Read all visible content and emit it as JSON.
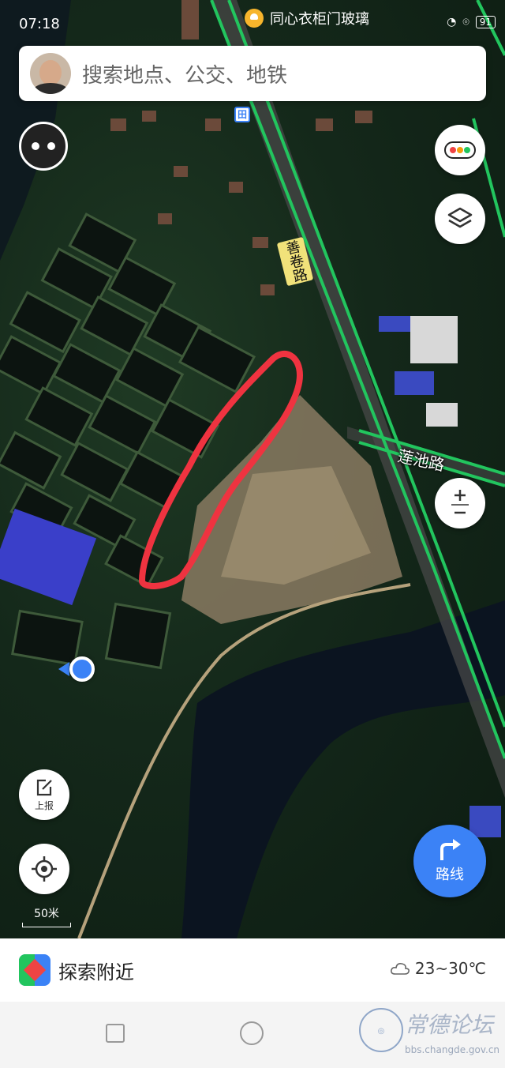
{
  "status_bar": {
    "time": "07:18",
    "notification_text": "同心衣柜门玻璃",
    "battery": "91"
  },
  "search": {
    "placeholder": "搜索地点、公交、地铁"
  },
  "map": {
    "road_labels": [
      "善卷路",
      "莲池路"
    ],
    "scale_label": "50米",
    "bus_marker": "田",
    "colors": {
      "road_line": "#22c55e",
      "highlight_loop": "#ef3340",
      "location_dot": "#3b82f6"
    }
  },
  "controls": {
    "traffic": "traffic-light-icon",
    "layers": "layers-icon",
    "zoom_in": "+",
    "zoom_out": "−",
    "report_label": "上报",
    "route_label": "路线"
  },
  "explore": {
    "title": "探索附近",
    "weather": "23~30℃"
  },
  "watermark": {
    "title": "常德论坛",
    "url": "bbs.changde.gov.cn",
    "seal_text": "常德论坛"
  }
}
